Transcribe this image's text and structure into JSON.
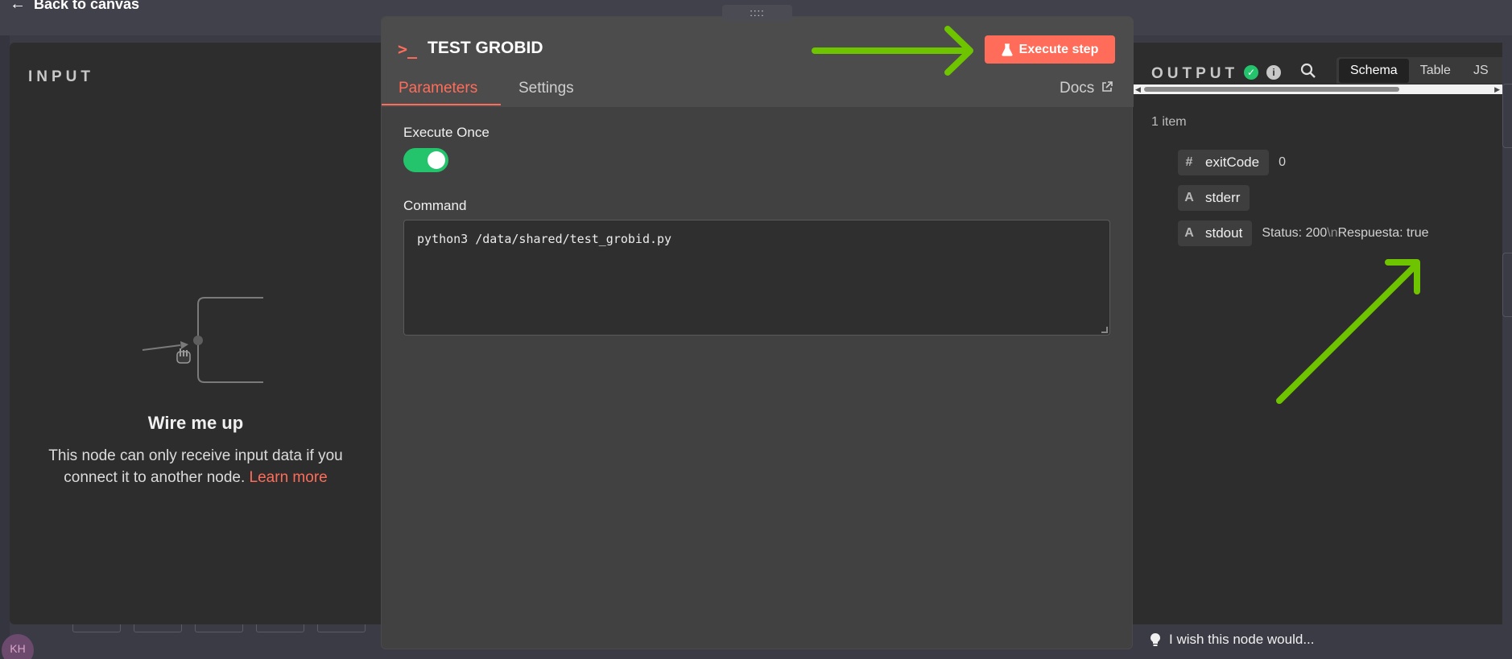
{
  "nav": {
    "back_label": "Back to canvas"
  },
  "avatar": {
    "initials": "KH"
  },
  "input_panel": {
    "title": "INPUT",
    "heading": "Wire me up",
    "message": "This node can only receive input data if you connect it to another node.",
    "learn_more": "Learn more"
  },
  "node": {
    "title": "TEST GROBID",
    "drag_handle": "::::",
    "execute_label": "Execute step",
    "tabs": [
      {
        "label": "Parameters",
        "active": true
      },
      {
        "label": "Settings",
        "active": false
      }
    ],
    "docs_label": "Docs",
    "execute_once_label": "Execute Once",
    "execute_once_enabled": true,
    "command_label": "Command",
    "command_value": "python3 /data/shared/test_grobid.py"
  },
  "output_panel": {
    "title": "OUTPUT",
    "view_tabs": [
      "Schema",
      "Table",
      "JS"
    ],
    "active_view": "Schema",
    "item_count": "1 item",
    "fields": [
      {
        "type_icon": "#",
        "name": "exitCode",
        "value": "0"
      },
      {
        "type_icon": "A",
        "name": "stderr",
        "value": ""
      },
      {
        "type_icon": "A",
        "name": "stdout",
        "value_part1": "Status: 200",
        "value_sep": "\\n",
        "value_part2": "Respuesta: true"
      }
    ]
  },
  "feedback": {
    "label": "I wish this node would..."
  },
  "colors": {
    "accent": "#ff6d5a",
    "success": "#23c46c",
    "annotation_arrow": "#6fc400"
  }
}
